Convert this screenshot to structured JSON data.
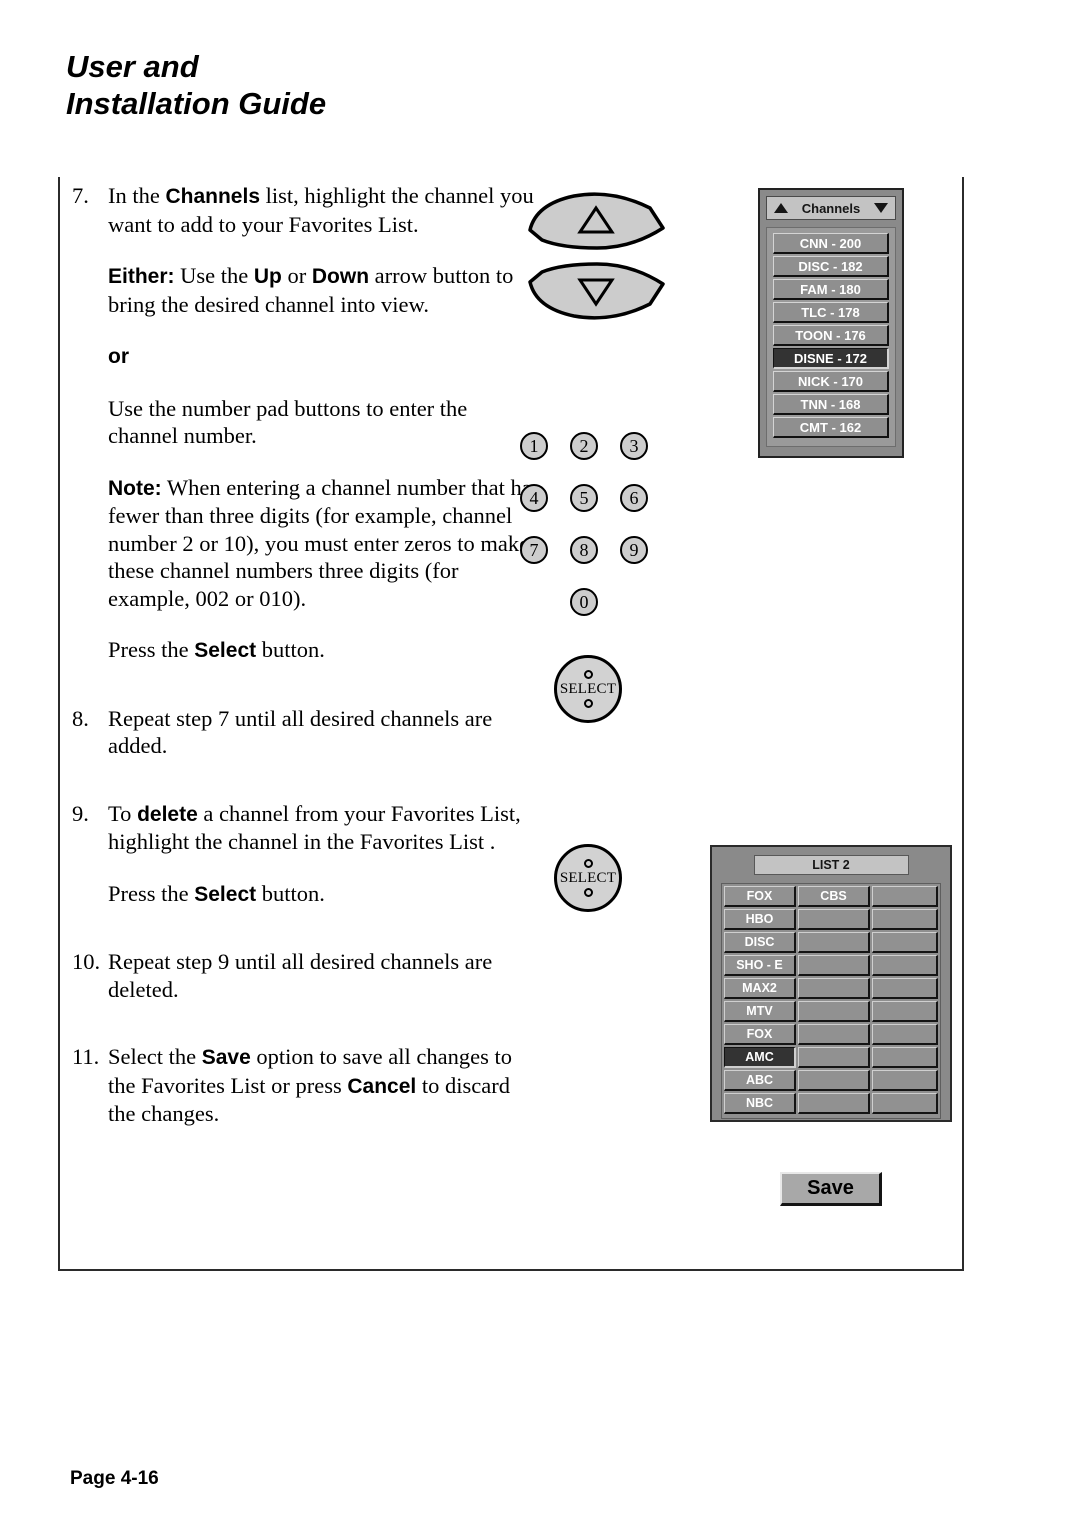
{
  "header": {
    "title_line1": "User and",
    "title_line2": "Installation Guide"
  },
  "steps": [
    {
      "number": "7.",
      "paragraphs": [
        {
          "parts": [
            {
              "t": "In the ",
              "b": false
            },
            {
              "t": "Channels",
              "b": true
            },
            {
              "t": " list, highlight the channel you want to add to your Favorites List.",
              "b": false
            }
          ]
        },
        {
          "parts": [
            {
              "t": "Either:",
              "b": true
            },
            {
              "t": "  Use the ",
              "b": false
            },
            {
              "t": "Up",
              "b": true
            },
            {
              "t": " or ",
              "b": false
            },
            {
              "t": "Down",
              "b": true
            },
            {
              "t": " arrow button to bring the desired channel into view.",
              "b": false
            }
          ]
        },
        {
          "parts": [
            {
              "t": "or",
              "b": true
            }
          ]
        },
        {
          "parts": [
            {
              "t": "Use the number pad buttons to enter the channel number.",
              "b": false
            }
          ]
        },
        {
          "parts": [
            {
              "t": "Note:",
              "b": true
            },
            {
              "t": "  When entering a channel number that has fewer than three digits (for example, channel number 2 or 10), you must enter zeros to make these channel numbers three digits (for example, 002 or 010).",
              "b": false
            }
          ]
        },
        {
          "parts": [
            {
              "t": "Press the ",
              "b": false
            },
            {
              "t": "Select",
              "b": true
            },
            {
              "t": " button.",
              "b": false
            }
          ]
        }
      ]
    },
    {
      "number": "8.",
      "paragraphs": [
        {
          "parts": [
            {
              "t": "Repeat step 7 until all desired channels are added.",
              "b": false
            }
          ]
        }
      ]
    },
    {
      "number": "9.",
      "paragraphs": [
        {
          "parts": [
            {
              "t": "To ",
              "b": false
            },
            {
              "t": "delete",
              "b": true
            },
            {
              "t": " a channel from your Favorites List, highlight the channel in the Favorites List .",
              "b": false
            }
          ]
        },
        {
          "parts": [
            {
              "t": "Press the ",
              "b": false
            },
            {
              "t": "Select",
              "b": true
            },
            {
              "t": " button.",
              "b": false
            }
          ]
        }
      ]
    },
    {
      "number": "10.",
      "paragraphs": [
        {
          "parts": [
            {
              "t": "Repeat step 9 until all desired channels are deleted.",
              "b": false
            }
          ]
        }
      ]
    },
    {
      "number": "11.",
      "paragraphs": [
        {
          "parts": [
            {
              "t": "Select the ",
              "b": false
            },
            {
              "t": "Save",
              "b": true
            },
            {
              "t": " option to save all changes to the Favorites List or press ",
              "b": false
            },
            {
              "t": "Cancel",
              "b": true
            },
            {
              "t": " to discard the changes.",
              "b": false
            }
          ]
        }
      ]
    }
  ],
  "remote": {
    "up_arrow_icon": "triangle-up-icon",
    "down_arrow_icon": "triangle-down-icon",
    "numpad_keys": [
      "1",
      "2",
      "3",
      "4",
      "5",
      "6",
      "7",
      "8",
      "9",
      "0"
    ],
    "select_label": "SELECT"
  },
  "channels_panel": {
    "title": "Channels",
    "up_icon": "triangle-up-icon",
    "down_icon": "triangle-down-icon",
    "items": [
      {
        "label": "CNN - 200",
        "selected": false
      },
      {
        "label": "DISC - 182",
        "selected": false
      },
      {
        "label": "FAM - 180",
        "selected": false
      },
      {
        "label": "TLC - 178",
        "selected": false
      },
      {
        "label": "TOON - 176",
        "selected": false
      },
      {
        "label": "DISNE - 172",
        "selected": true
      },
      {
        "label": "NICK - 170",
        "selected": false
      },
      {
        "label": "TNN - 168",
        "selected": false
      },
      {
        "label": "CMT - 162",
        "selected": false
      }
    ]
  },
  "favorites_panel": {
    "title": "LIST 2",
    "rows": [
      {
        "cells": [
          "FOX",
          "CBS",
          ""
        ],
        "selected": false
      },
      {
        "cells": [
          "HBO",
          "",
          ""
        ],
        "selected": false
      },
      {
        "cells": [
          "DISC",
          "",
          ""
        ],
        "selected": false
      },
      {
        "cells": [
          "SHO - E",
          "",
          ""
        ],
        "selected": false
      },
      {
        "cells": [
          "MAX2",
          "",
          ""
        ],
        "selected": false
      },
      {
        "cells": [
          "MTV",
          "",
          ""
        ],
        "selected": false
      },
      {
        "cells": [
          "FOX",
          "",
          ""
        ],
        "selected": false
      },
      {
        "cells": [
          "AMC",
          "",
          ""
        ],
        "selected": true
      },
      {
        "cells": [
          "ABC",
          "",
          ""
        ],
        "selected": false
      },
      {
        "cells": [
          "NBC",
          "",
          ""
        ],
        "selected": false
      }
    ]
  },
  "save_button": {
    "label": "Save"
  },
  "footer": {
    "page": "Page 4-16"
  }
}
